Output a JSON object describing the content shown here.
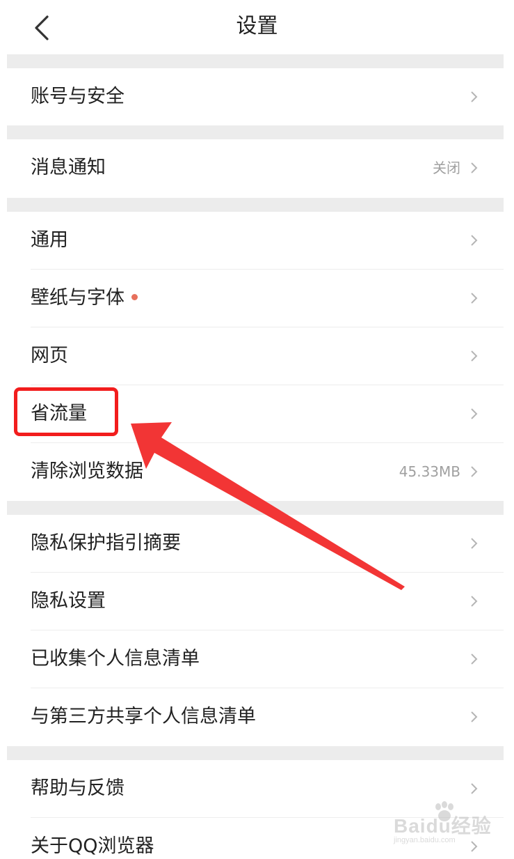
{
  "header": {
    "title": "设置",
    "back_icon": "chevron-left-icon"
  },
  "rows": [
    {
      "label": "账号与安全",
      "value": "",
      "chevron": "chevron-right-icon"
    },
    {
      "label": "消息通知",
      "value": "关闭",
      "chevron": "chevron-right-icon"
    },
    {
      "label": "通用",
      "value": "",
      "chevron": "chevron-right-icon"
    },
    {
      "label": "壁纸与字体",
      "value": "",
      "chevron": "chevron-right-icon",
      "badge": "red-dot"
    },
    {
      "label": "网页",
      "value": "",
      "chevron": "chevron-right-icon"
    },
    {
      "label": "省流量",
      "value": "",
      "chevron": "chevron-right-icon"
    },
    {
      "label": "清除浏览数据",
      "value": "45.33MB",
      "chevron": "chevron-right-icon"
    },
    {
      "label": "隐私保护指引摘要",
      "value": "",
      "chevron": "chevron-right-icon"
    },
    {
      "label": "隐私设置",
      "value": "",
      "chevron": "chevron-right-icon"
    },
    {
      "label": "已收集个人信息清单",
      "value": "",
      "chevron": "chevron-right-icon"
    },
    {
      "label": "与第三方共享个人信息清单",
      "value": "",
      "chevron": "chevron-right-icon"
    },
    {
      "label": "帮助与反馈",
      "value": "",
      "chevron": "chevron-right-icon"
    },
    {
      "label": "关于QQ浏览器",
      "value": "",
      "chevron": "chevron-right-icon"
    }
  ],
  "annotation": {
    "highlight_color": "#f21d1d",
    "arrow_color": "#f23535"
  },
  "watermark": {
    "main": "Baidu经验",
    "sub": "jingyan.baidu.com"
  }
}
